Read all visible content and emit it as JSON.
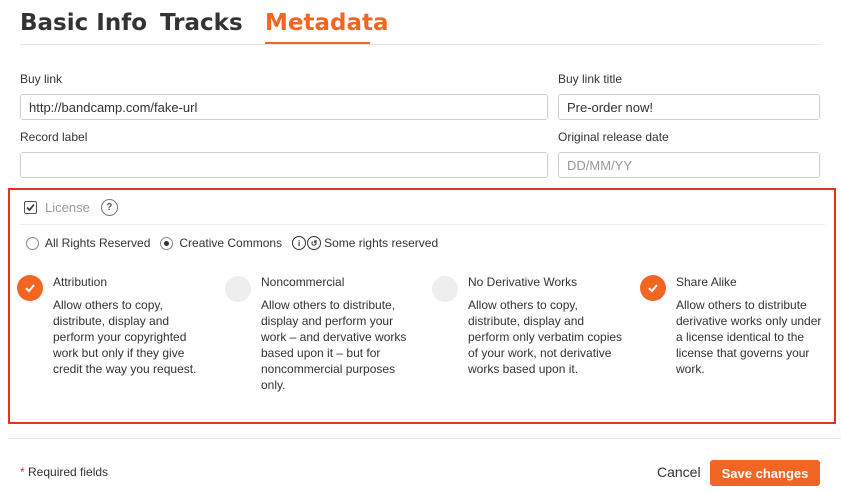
{
  "tabs": [
    {
      "label": "Basic Info",
      "active": false
    },
    {
      "label": "Tracks",
      "active": false
    },
    {
      "label": "Metadata",
      "active": true
    }
  ],
  "fields": {
    "buy_link": {
      "label": "Buy link",
      "value": "http://bandcamp.com/fake-url",
      "placeholder": ""
    },
    "buy_link_title": {
      "label": "Buy link title",
      "value": "Pre-order now!",
      "placeholder": ""
    },
    "record_label": {
      "label": "Record label",
      "value": "",
      "placeholder": ""
    },
    "release_date": {
      "label": "Original release date",
      "value": "",
      "placeholder": "DD/MM/YY"
    }
  },
  "license": {
    "title": "License",
    "checked": true,
    "help_icon": "question-icon",
    "options": [
      {
        "label": "All Rights Reserved",
        "selected": false
      },
      {
        "label": "Creative Commons",
        "selected": true
      }
    ],
    "cc_status": "Some rights reserved",
    "conditions": [
      {
        "title": "Attribution",
        "checked": true,
        "description": "Allow others to copy, distribute, display and perform your copyrighted work but only if they give credit the way you request."
      },
      {
        "title": "Noncommercial",
        "checked": false,
        "description": "Allow others to distribute, display and perform your work – and dervative works based upon it – but for noncommercial purposes only."
      },
      {
        "title": "No Derivative Works",
        "checked": false,
        "description": "Allow others to copy, distribute, display and perform only verbatim copies of your work, not derivative works based upon it."
      },
      {
        "title": "Share Alike",
        "checked": true,
        "description": "Allow others to distribute derivative works only under a license identical to the license that governs your work."
      }
    ]
  },
  "footer": {
    "required_star": "*",
    "required_text": "Required fields",
    "cancel_label": "Cancel",
    "save_label": "Save changes"
  },
  "colors": {
    "accent": "#f26522",
    "highlight_border": "#e8311f"
  }
}
